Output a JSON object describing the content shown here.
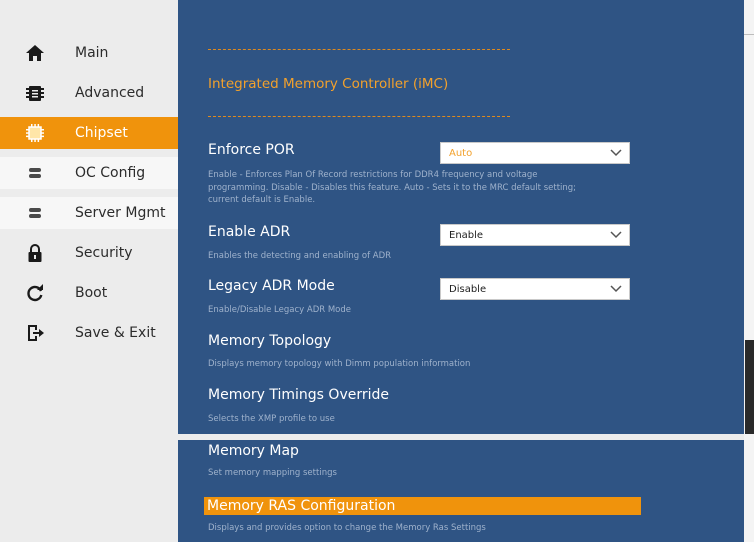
{
  "sidebar": {
    "items": [
      {
        "label": "Main",
        "icon": "home-icon"
      },
      {
        "label": "Advanced",
        "icon": "chip-settings-icon"
      },
      {
        "label": "Chipset",
        "icon": "chip-icon",
        "active": true
      },
      {
        "label": "OC Config",
        "icon": "server-icon"
      },
      {
        "label": "Server Mgmt",
        "icon": "server-icon"
      },
      {
        "label": "Security",
        "icon": "lock-icon"
      },
      {
        "label": "Boot",
        "icon": "refresh-icon"
      },
      {
        "label": "Save & Exit",
        "icon": "exit-icon"
      }
    ]
  },
  "main": {
    "section_title": "Integrated Memory Controller (iMC)",
    "settings": [
      {
        "label": "Enforce POR",
        "value": "Auto",
        "help": "Enable - Enforces Plan Of Record restrictions for DDR4 frequency and voltage programming. Disable - Disables this feature. Auto - Sets it to the MRC default setting; current default is Enable."
      },
      {
        "label": "Enable ADR",
        "value": "Enable",
        "help": "Enables the detecting and enabling of ADR"
      },
      {
        "label": "Legacy ADR Mode",
        "value": "Disable",
        "help": "Enable/Disable Legacy ADR Mode"
      },
      {
        "label": "Memory Topology",
        "help": "Displays memory topology with Dimm population information"
      },
      {
        "label": "Memory Timings Override",
        "help": "Selects the XMP profile to use"
      },
      {
        "label": "Memory Map",
        "help": "Set memory mapping settings"
      },
      {
        "label": "Memory RAS Configuration",
        "help": "Displays and provides option to change the Memory Ras Settings"
      }
    ]
  },
  "colors": {
    "panel": "#2f5484",
    "accent": "#f0930c",
    "sidebar": "#ececec"
  }
}
